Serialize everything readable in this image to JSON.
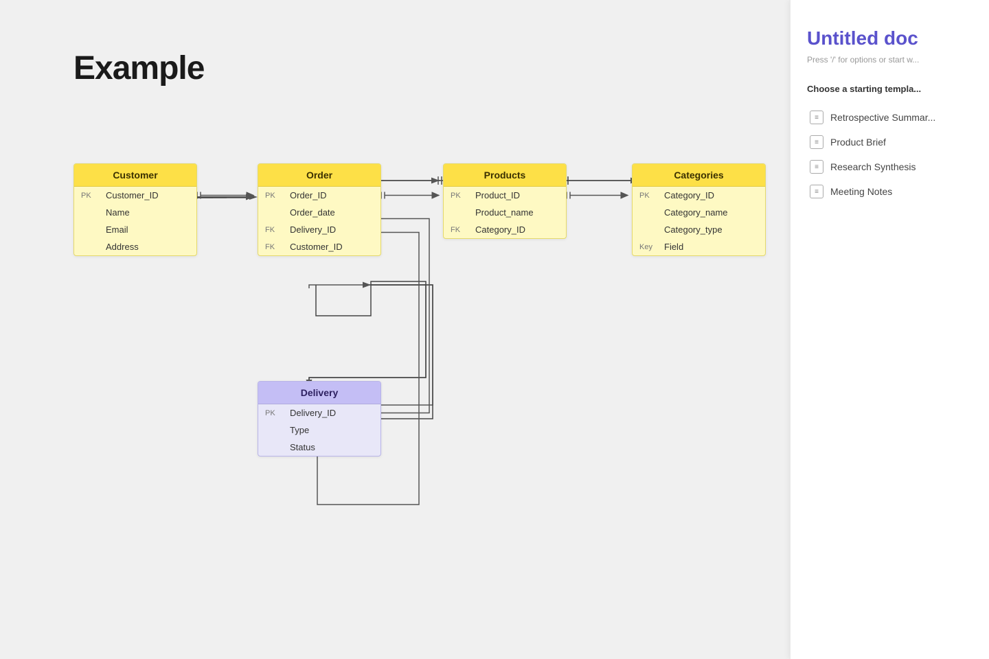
{
  "page": {
    "title": "Example"
  },
  "erd": {
    "tables": {
      "customer": {
        "header": "Customer",
        "color": "yellow",
        "rows": [
          {
            "key": "PK",
            "field": "Customer_ID"
          },
          {
            "key": "",
            "field": "Name"
          },
          {
            "key": "",
            "field": "Email"
          },
          {
            "key": "",
            "field": "Address"
          }
        ]
      },
      "order": {
        "header": "Order",
        "color": "yellow",
        "rows": [
          {
            "key": "PK",
            "field": "Order_ID"
          },
          {
            "key": "",
            "field": "Order_date"
          },
          {
            "key": "FK",
            "field": "Delivery_ID"
          },
          {
            "key": "FK",
            "field": "Customer_ID"
          }
        ]
      },
      "products": {
        "header": "Products",
        "color": "yellow",
        "rows": [
          {
            "key": "PK",
            "field": "Product_ID"
          },
          {
            "key": "",
            "field": "Product_name"
          },
          {
            "key": "FK",
            "field": "Category_ID"
          }
        ]
      },
      "categories": {
        "header": "Categories",
        "color": "yellow",
        "rows": [
          {
            "key": "PK",
            "field": "Category_ID"
          },
          {
            "key": "",
            "field": "Category_name"
          },
          {
            "key": "",
            "field": "Category_type"
          },
          {
            "key": "Key",
            "field": "Field"
          }
        ]
      },
      "delivery": {
        "header": "Delivery",
        "color": "purple",
        "rows": [
          {
            "key": "PK",
            "field": "Delivery_ID"
          },
          {
            "key": "",
            "field": "Type"
          },
          {
            "key": "",
            "field": "Status"
          }
        ]
      }
    }
  },
  "right_panel": {
    "doc_title": "Untitled doc",
    "hint": "Press '/' for options or start w...",
    "section_title": "Choose a starting templa...",
    "templates": [
      {
        "label": "Retrospective Summar..."
      },
      {
        "label": "Product Brief"
      },
      {
        "label": "Research Synthesis"
      },
      {
        "label": "Meeting Notes"
      }
    ]
  }
}
